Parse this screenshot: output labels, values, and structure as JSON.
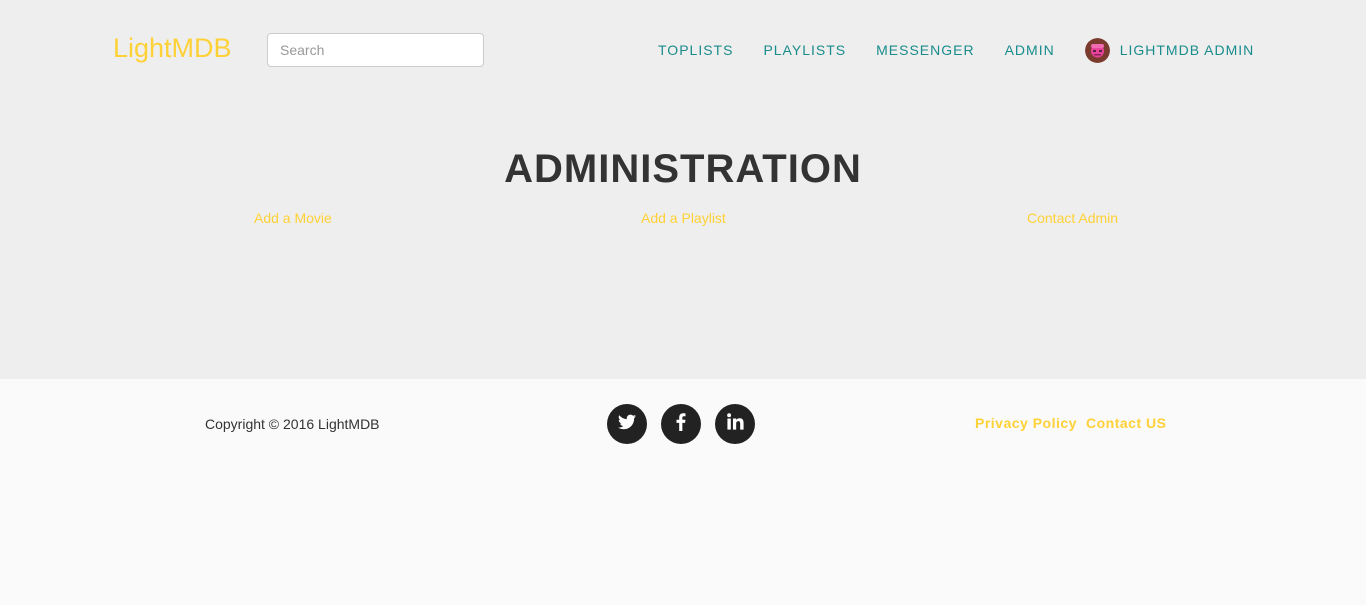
{
  "header": {
    "brand": "LightMDB",
    "search_placeholder": "Search",
    "nav": [
      {
        "label": "TOPLISTS"
      },
      {
        "label": "PLAYLISTS"
      },
      {
        "label": "MESSENGER"
      },
      {
        "label": "ADMIN"
      }
    ],
    "user": {
      "label": "LIGHTMDB ADMIN",
      "avatar_icon": "user-avatar"
    }
  },
  "main": {
    "title": "ADMINISTRATION",
    "links": [
      {
        "label": "Add a Movie"
      },
      {
        "label": "Add a Playlist"
      },
      {
        "label": "Contact Admin"
      }
    ]
  },
  "footer": {
    "copyright": "Copyright © 2016 LightMDB",
    "social": [
      {
        "icon": "twitter-icon"
      },
      {
        "icon": "facebook-icon"
      },
      {
        "icon": "linkedin-icon"
      }
    ],
    "links": [
      {
        "label": "Privacy Policy"
      },
      {
        "label": "Contact US"
      }
    ]
  },
  "colors": {
    "accent": "#fed136",
    "nav": "#1a8c8c",
    "top_bg": "#eeeeee",
    "footer_bg": "#fafafa",
    "social_bg": "#222222"
  }
}
